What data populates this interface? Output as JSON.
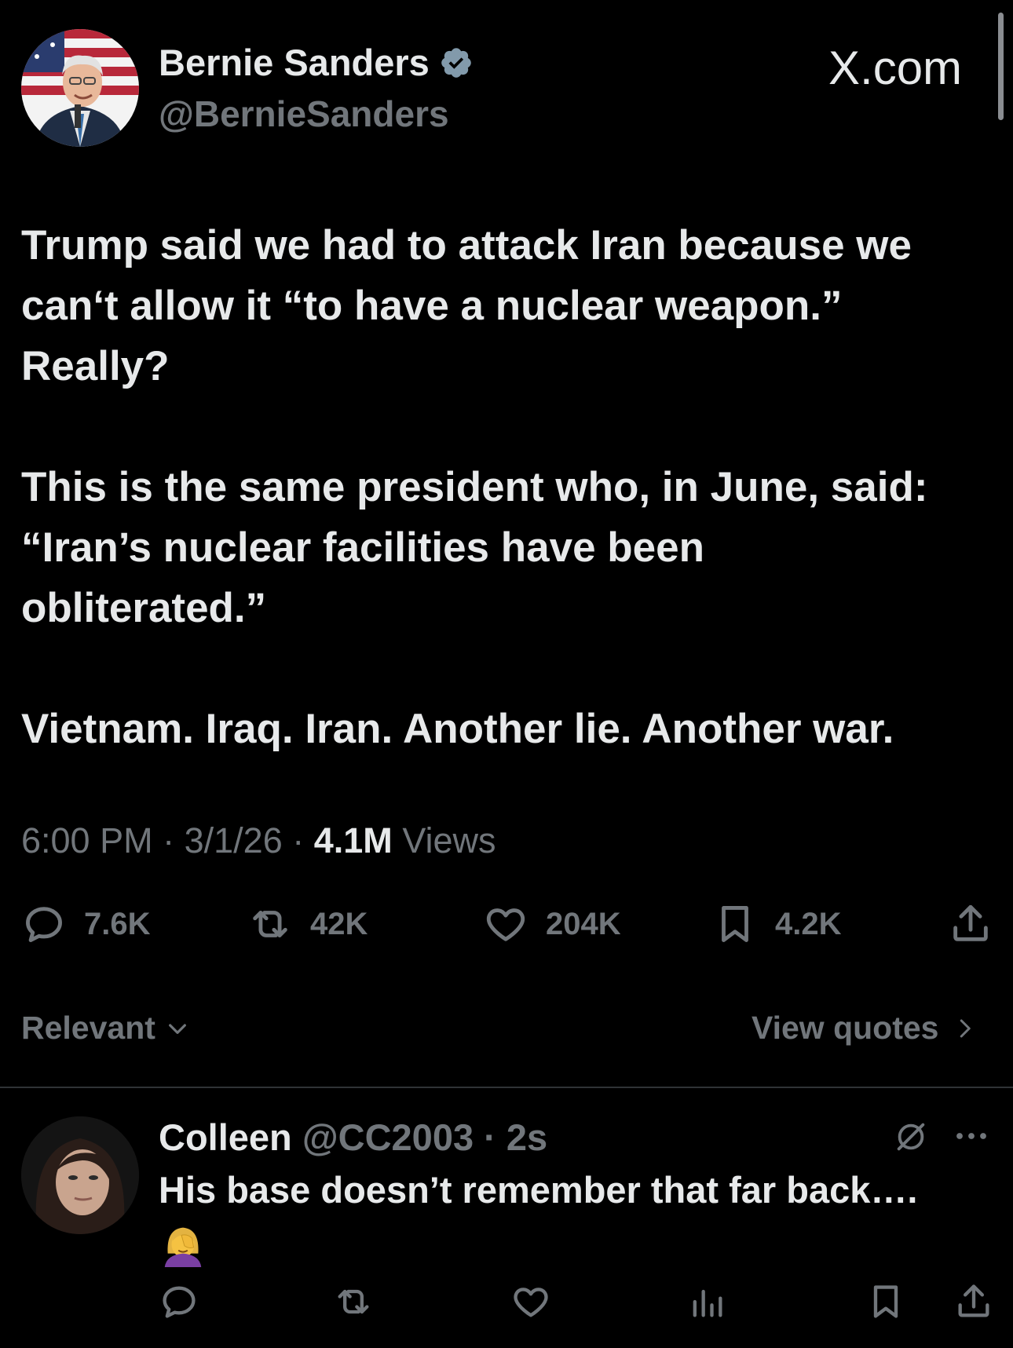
{
  "tweet": {
    "author_name": "Bernie Sanders",
    "author_handle": "@BernieSanders",
    "watermark": "X.com",
    "text_lines": [
      "Trump said we had to attack Iran because we",
      "can‘t allow it “to have a nuclear weapon.”",
      "Really?",
      "",
      "This is the same president who, in June, said:",
      "“Iran’s nuclear facilities have been",
      "obliterated.”",
      "",
      "Vietnam. Iraq. Iran. Another lie. Another war."
    ],
    "time": "6:00 PM",
    "date": "3/1/26",
    "views_count": "4.1M",
    "views_label": "Views",
    "stats": {
      "replies": "7.6K",
      "reposts": "42K",
      "likes": "204K",
      "bookmarks": "4.2K"
    }
  },
  "sort": {
    "label": "Relevant",
    "view_quotes": "View quotes"
  },
  "reply": {
    "author_name": "Colleen",
    "author_handle": "@CC2003",
    "time": "2s",
    "text": "His base doesn’t remember that far back….",
    "emoji": "woman-facepalming"
  },
  "colors": {
    "background": "#000000",
    "text": "#e7e9ea",
    "muted": "#71767b",
    "verified_badge": "#829aab"
  }
}
